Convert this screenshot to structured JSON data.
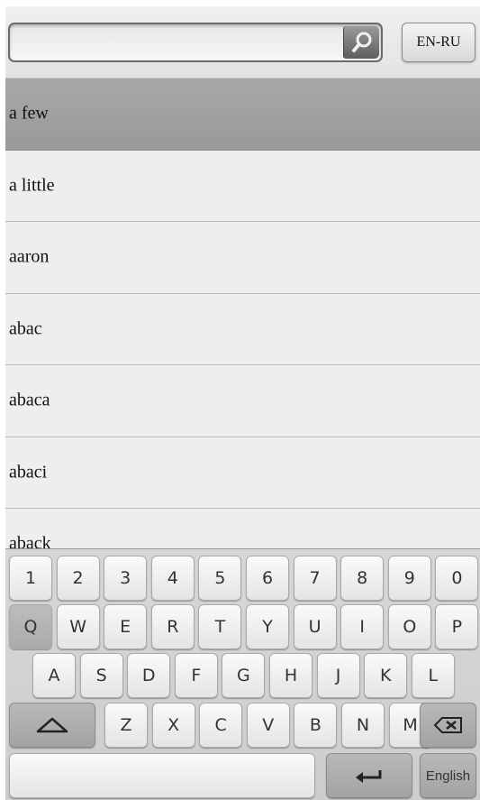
{
  "search": {
    "value": "",
    "placeholder": ""
  },
  "icons": {
    "search_button": "search-icon",
    "shift": "shift-icon",
    "backspace": "backspace-icon",
    "enter": "enter-icon"
  },
  "lang_toggle": "EN-RU",
  "words": [
    "a few",
    "a little",
    "aaron",
    "abac",
    "abaca",
    "abaci",
    "aback"
  ],
  "selected_index": 0,
  "keyboard": {
    "row_numbers": [
      "1",
      "2",
      "3",
      "4",
      "5",
      "6",
      "7",
      "8",
      "9",
      "0"
    ],
    "row_top": [
      "Q",
      "W",
      "E",
      "R",
      "T",
      "Y",
      "U",
      "I",
      "O",
      "P"
    ],
    "row_middle": [
      "A",
      "S",
      "D",
      "F",
      "G",
      "H",
      "J",
      "K",
      "L"
    ],
    "row_bottom": [
      "Z",
      "X",
      "C",
      "V",
      "B",
      "N",
      "M"
    ],
    "language_label": "English"
  }
}
